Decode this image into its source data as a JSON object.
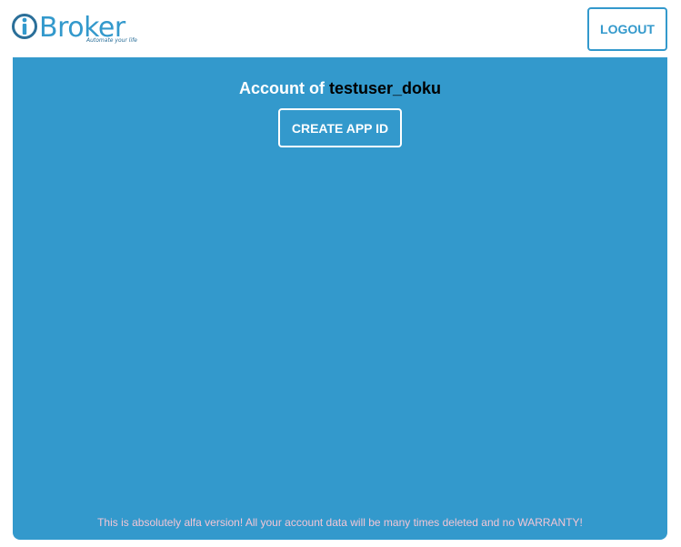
{
  "header": {
    "logo": {
      "brand": "Broker",
      "tagline": "Automate your life",
      "icon": "ibroker-i-logo-icon",
      "color": "#3399cc"
    },
    "logout_label": "LOGOUT"
  },
  "main": {
    "background": "#3399cc",
    "account_prefix": "Account of ",
    "username": "testuser_doku",
    "create_app_id_label": "CREATE APP ID",
    "footer_note": "This is absolutely alfa version! All your account data will be many times deleted and no WARRANTY!"
  }
}
